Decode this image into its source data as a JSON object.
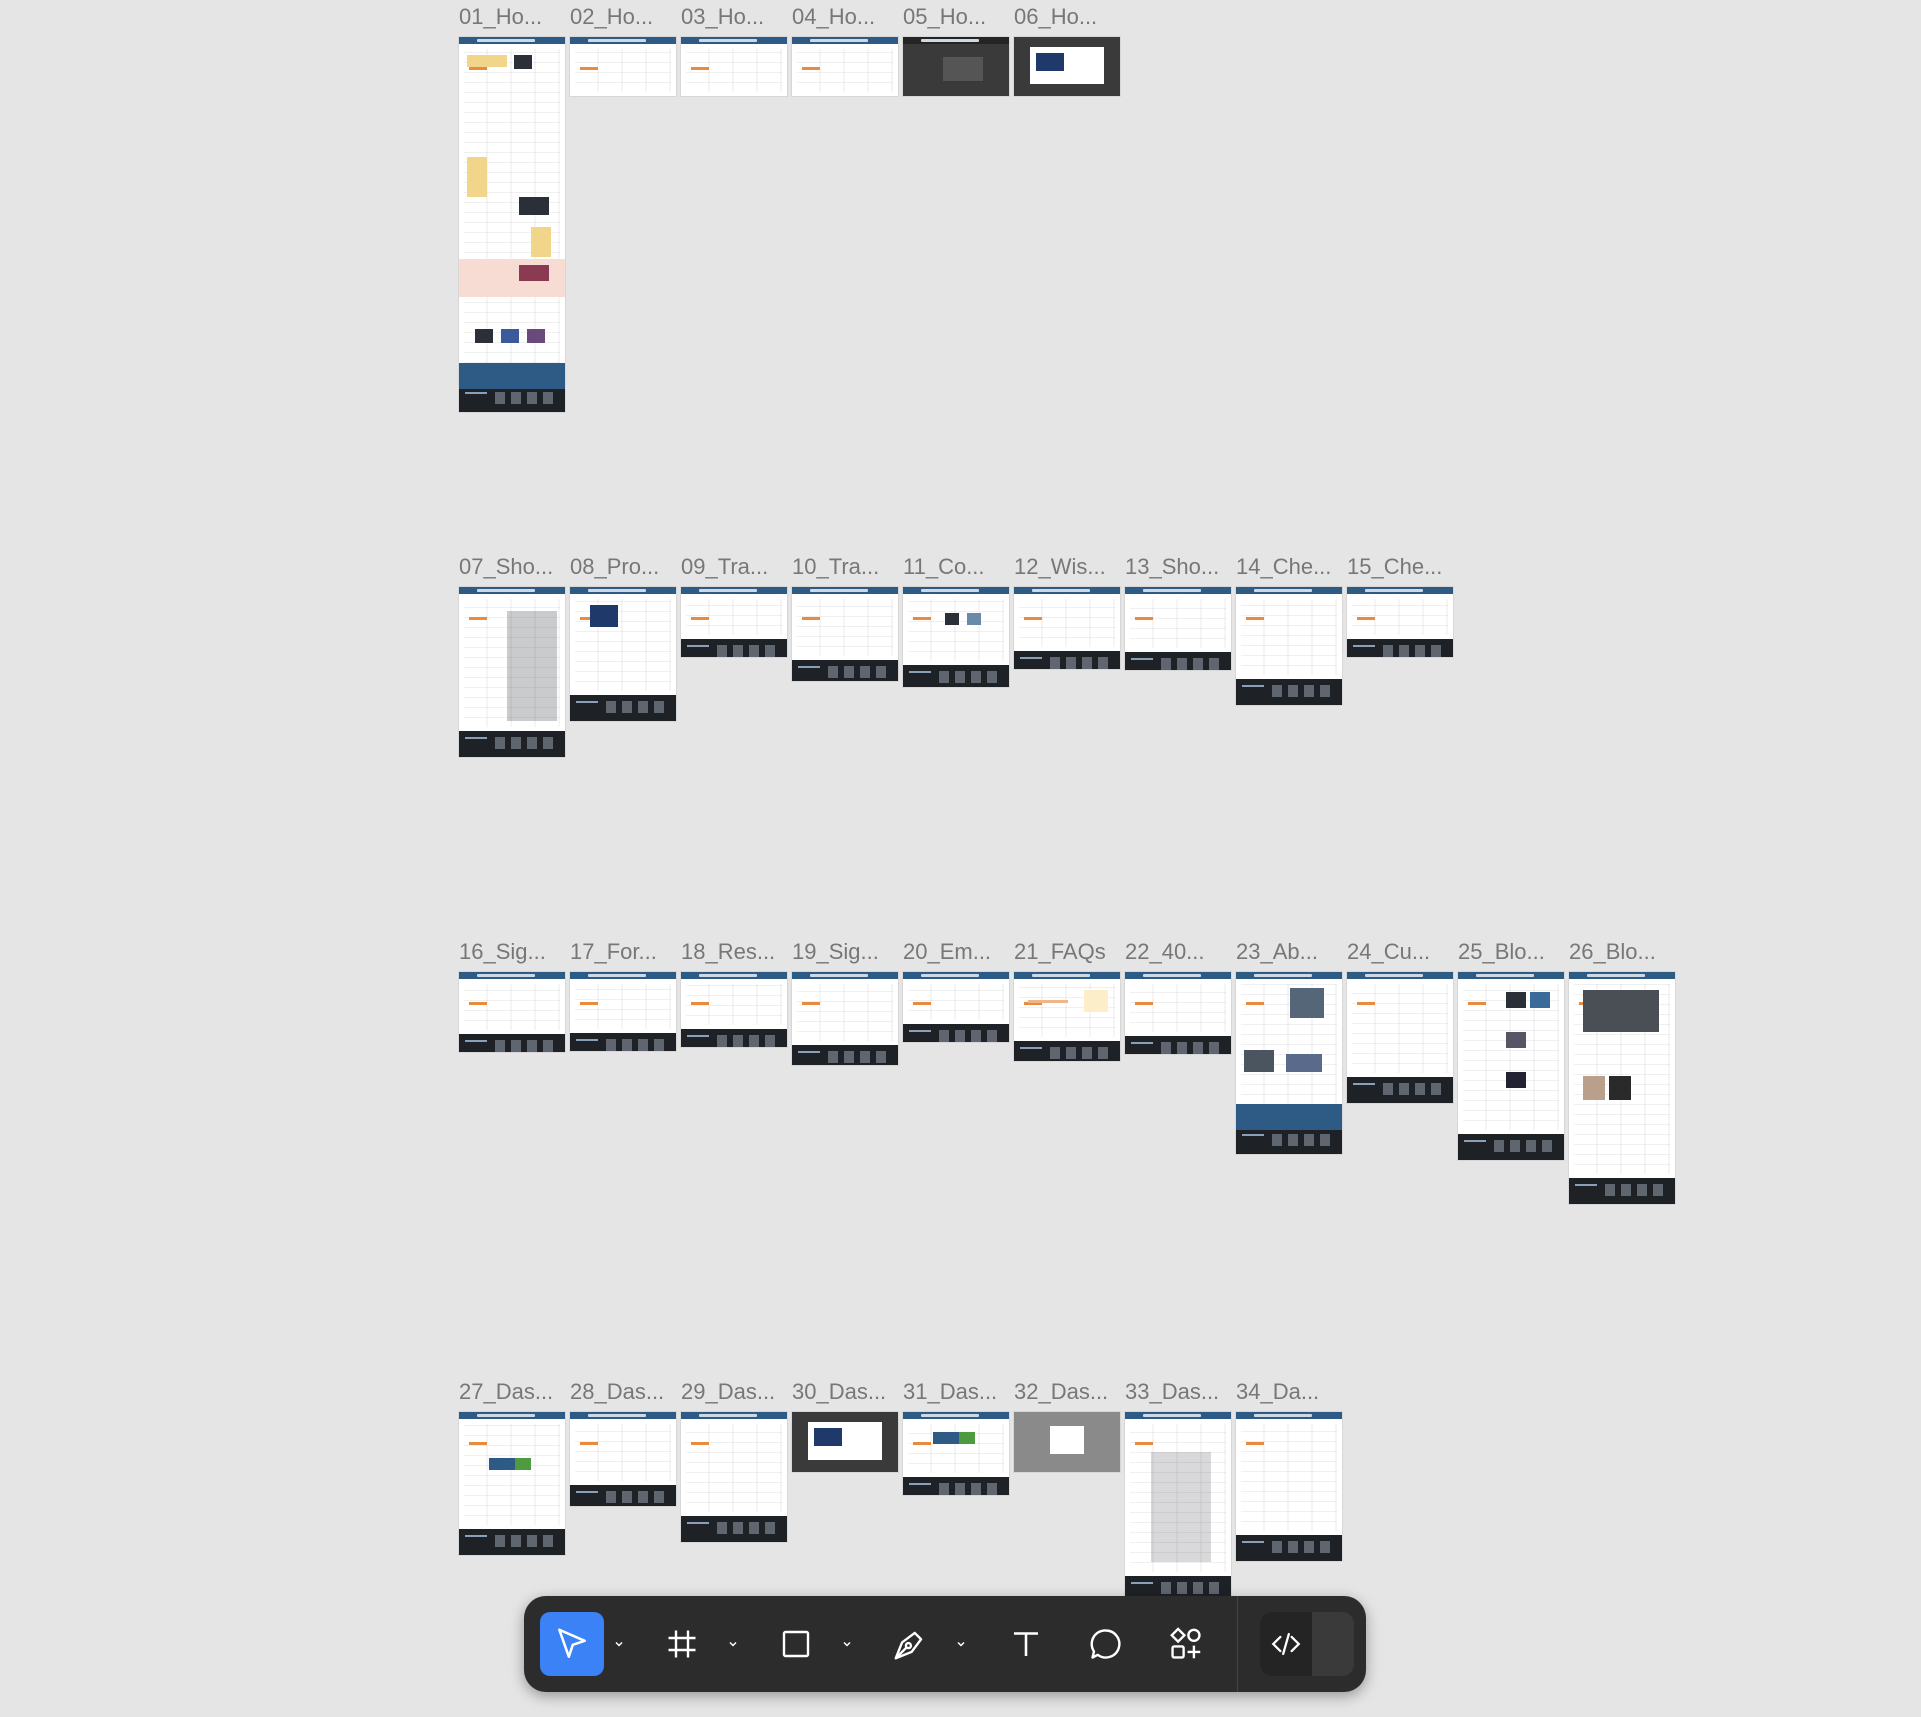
{
  "frames": [
    {
      "label": "01_Ho...",
      "theme": "home-long"
    },
    {
      "label": "02_Ho...",
      "theme": "light"
    },
    {
      "label": "03_Ho...",
      "theme": "light"
    },
    {
      "label": "04_Ho...",
      "theme": "light"
    },
    {
      "label": "05_Ho...",
      "theme": "dark"
    },
    {
      "label": "06_Ho...",
      "theme": "dark-modal"
    },
    {
      "label": "07_Sho...",
      "theme": "shop"
    },
    {
      "label": "08_Pro...",
      "theme": "product"
    },
    {
      "label": "09_Tra...",
      "theme": "light"
    },
    {
      "label": "10_Tra...",
      "theme": "light"
    },
    {
      "label": "11_Co...",
      "theme": "compare"
    },
    {
      "label": "12_Wis...",
      "theme": "light"
    },
    {
      "label": "13_Sho...",
      "theme": "light"
    },
    {
      "label": "14_Che...",
      "theme": "light"
    },
    {
      "label": "15_Che...",
      "theme": "light"
    },
    {
      "label": "16_Sig...",
      "theme": "light"
    },
    {
      "label": "17_For...",
      "theme": "light"
    },
    {
      "label": "18_Res...",
      "theme": "light"
    },
    {
      "label": "19_Sig...",
      "theme": "light"
    },
    {
      "label": "20_Em...",
      "theme": "light"
    },
    {
      "label": "21_FAQs",
      "theme": "faq"
    },
    {
      "label": "22_40...",
      "theme": "light"
    },
    {
      "label": "23_Ab...",
      "theme": "about"
    },
    {
      "label": "24_Cu...",
      "theme": "light"
    },
    {
      "label": "25_Blo...",
      "theme": "blog"
    },
    {
      "label": "26_Blo...",
      "theme": "blog-detail"
    },
    {
      "label": "27_Das...",
      "theme": "dash-green"
    },
    {
      "label": "28_Das...",
      "theme": "light"
    },
    {
      "label": "29_Das...",
      "theme": "light"
    },
    {
      "label": "30_Das...",
      "theme": "dark-modal"
    },
    {
      "label": "31_Das...",
      "theme": "dash-green"
    },
    {
      "label": "32_Das...",
      "theme": "dim-modal"
    },
    {
      "label": "33_Das...",
      "theme": "dash-list"
    },
    {
      "label": "34_Da...",
      "theme": "light"
    }
  ],
  "toolbar": {
    "tools": [
      {
        "name": "move-tool",
        "icon": "cursor-arrow-icon",
        "active": true
      },
      {
        "name": "frame-tool",
        "icon": "frame-hash-icon",
        "active": false
      },
      {
        "name": "shape-tool",
        "icon": "rectangle-icon",
        "active": false
      },
      {
        "name": "pen-tool",
        "icon": "pen-nib-icon",
        "active": false
      },
      {
        "name": "text-tool",
        "icon": "text-t-icon",
        "active": false
      },
      {
        "name": "comment-tool",
        "icon": "comment-bubble-icon",
        "active": false
      },
      {
        "name": "resources-tool",
        "icon": "shapes-plus-icon",
        "active": false
      },
      {
        "name": "dev-mode-toggle",
        "icon": "code-brackets-icon",
        "active": false
      }
    ],
    "active_color": "#3b82f6",
    "background": "#2c2c2c"
  },
  "canvas_background": "#e5e5e5"
}
